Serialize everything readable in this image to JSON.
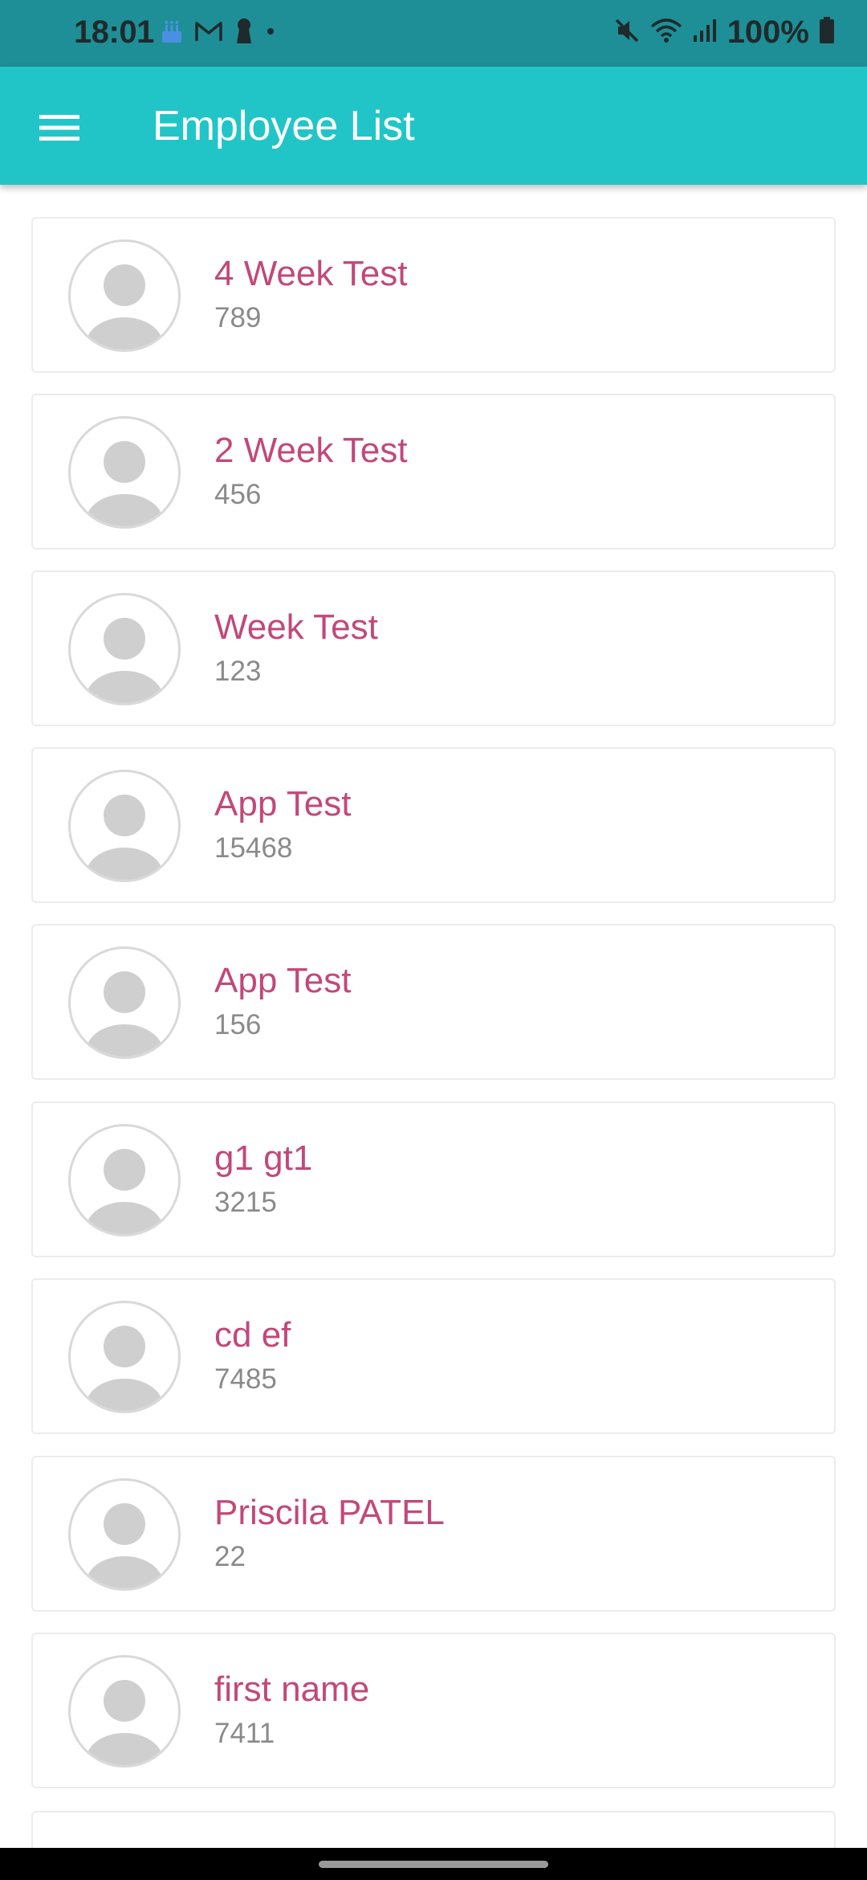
{
  "status_bar": {
    "time": "18:01",
    "left_icons": [
      "cake-icon",
      "gmail-icon",
      "keyhole-icon",
      "dot-icon"
    ],
    "right_icons": [
      "mute-icon",
      "wifi-icon",
      "signal-icon",
      "battery-icon"
    ],
    "battery": "100%"
  },
  "app_bar": {
    "title": "Employee List",
    "menu_icon": "hamburger-menu-icon",
    "color": "#22c5c7"
  },
  "employees": [
    {
      "name": "4 Week Test",
      "id": "789"
    },
    {
      "name": "2 Week Test",
      "id": "456"
    },
    {
      "name": "Week Test",
      "id": "123"
    },
    {
      "name": "App Test",
      "id": "15468"
    },
    {
      "name": "App Test",
      "id": "156"
    },
    {
      "name": "g1 gt1",
      "id": "3215"
    },
    {
      "name": "cd ef",
      "id": "7485"
    },
    {
      "name": "Priscila PATEL",
      "id": "22"
    },
    {
      "name": "first name",
      "id": "7411"
    }
  ],
  "colors": {
    "name_text": "#c2487a",
    "id_text": "#8a8a8a",
    "status_bar": "#1e8f96"
  }
}
